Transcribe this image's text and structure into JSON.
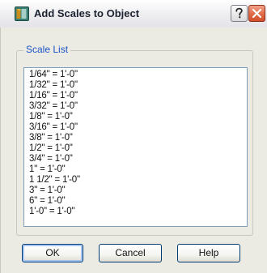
{
  "window": {
    "title": "Add Scales to Object",
    "icon": "autocad-app-icon",
    "help_icon": "question-mark-icon",
    "close_icon": "close-x-icon"
  },
  "scale_list": {
    "label": "Scale List",
    "items": [
      "1/64\" = 1'-0\"",
      "1/32\" = 1'-0\"",
      "1/16\" = 1'-0\"",
      "3/32\" = 1'-0\"",
      "1/8\" = 1'-0\"",
      "3/16\" = 1'-0\"",
      "3/8\" = 1'-0\"",
      "1/2\" = 1'-0\"",
      "3/4\" = 1'-0\"",
      "1\" = 1'-0\"",
      "1 1/2\" = 1'-0\"",
      "3\" = 1'-0\"",
      "6\" = 1'-0\"",
      "1'-0\" = 1'-0\""
    ]
  },
  "buttons": {
    "ok": "OK",
    "cancel": "Cancel",
    "help": "Help"
  },
  "colors": {
    "group_label": "#1a52c8",
    "dialog_face": "#ecebe3",
    "close_button": "#e06a47",
    "listbox_border": "#7f9db9"
  }
}
